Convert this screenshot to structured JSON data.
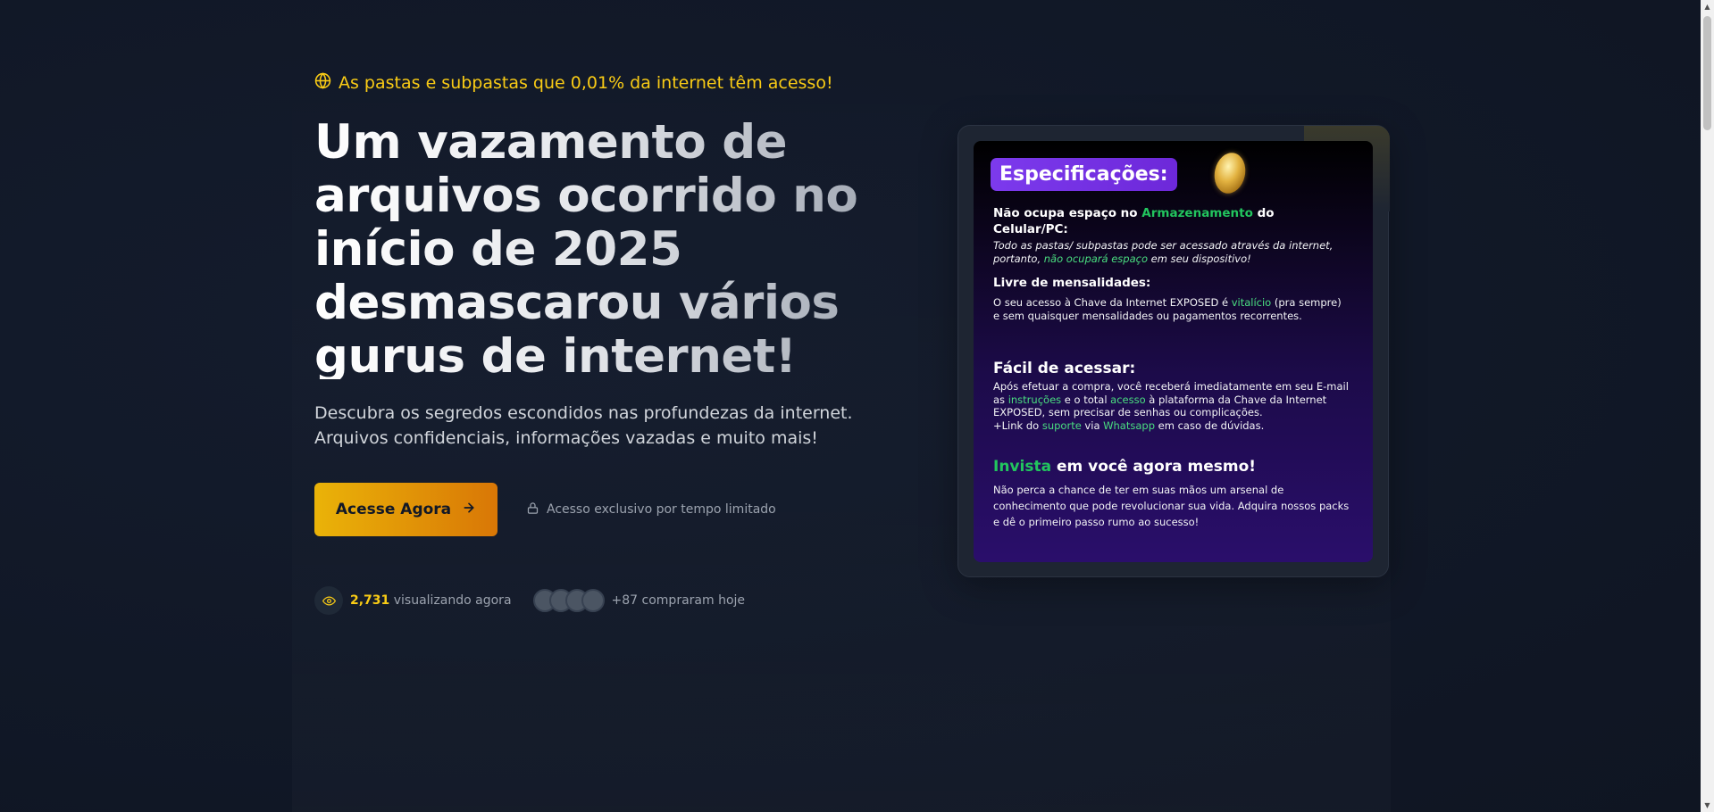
{
  "hero": {
    "tagline": "As pastas e subpastas que 0,01% da internet têm acesso!",
    "headline": "Um vazamento de arquivos ocorrido no início de 2025 desmascarou vários gurus de internet!",
    "subtitle": "Descubra os segredos escondidos nas profundezas da internet. Arquivos confidenciais, informações vazadas e muito mais!",
    "cta_label": "Acesse Agora",
    "cta_icon": "arrow-right-icon",
    "lock_note": "Acesso exclusivo por tempo limitado",
    "viewers_count": "2,731",
    "viewers_label": "visualizando agora",
    "buyers_label": "+87 compraram hoje"
  },
  "colors": {
    "accent": "#facc15",
    "cta_start": "#eab308",
    "cta_end": "#d97706",
    "background": "#111827",
    "spec_highlight": "#4ade80",
    "spec_title_bg": "#7c3aed"
  },
  "spec_card": {
    "title": "Especificações:",
    "storage": {
      "heading_pre": "Não ocupa espaço no ",
      "heading_hl": "Armazenamento",
      "heading_post": " do Celular/PC:",
      "text_a": "Todo as pastas/ subpastas pode ser acessado através da internet, portanto, ",
      "text_hl": "não ocupará espaço",
      "text_b": " em seu dispositivo!"
    },
    "monthly": {
      "heading": "Livre de mensalidades:",
      "text_a": "O seu acesso à Chave da Internet EXPOSED é ",
      "text_hl": "vitalício",
      "text_b": " (pra sempre) e sem quaisquer mensalidades ou pagamentos recorrentes."
    },
    "access": {
      "heading": "Fácil de acessar:",
      "text_a": "Após efetuar a compra, você receberá imediatamente em seu E-mail as ",
      "hl_1": "instruções",
      "text_b": " e o total ",
      "hl_2": "acesso",
      "text_c": " à plataforma da Chave da Internet EXPOSED, sem precisar de senhas ou complicações.",
      "text_d": "+Link do ",
      "hl_3": "suporte",
      "text_e": " via ",
      "hl_4": "Whatsapp",
      "text_f": " em caso de dúvidas."
    },
    "invest": {
      "heading_hl": "Invista",
      "heading_post": " em você agora mesmo!",
      "text": "Não perca a chance de ter em suas mãos um arsenal de conhecimento que pode revolucionar sua vida. Adquira nossos packs e dê o primeiro passo rumo ao sucesso!"
    }
  }
}
